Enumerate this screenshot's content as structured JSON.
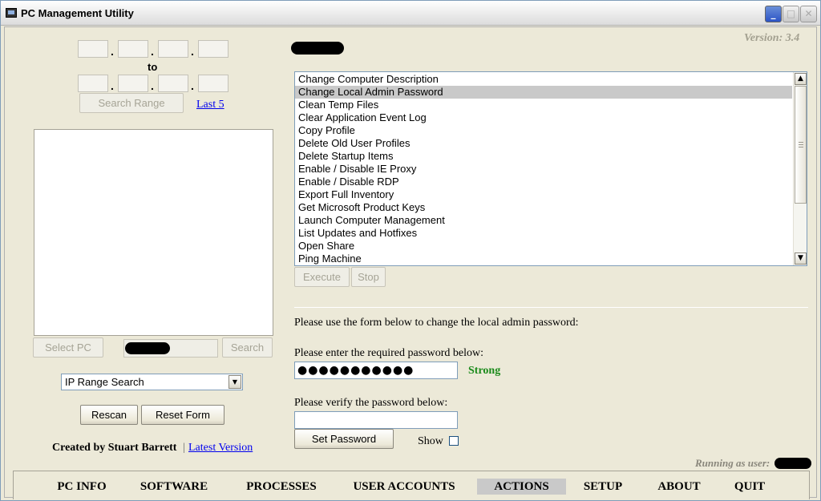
{
  "window": {
    "title": "PC Management Utility",
    "controls": {
      "minimize": "_",
      "maximize": "□",
      "close": "✕"
    }
  },
  "version": "Version: 3.4",
  "ip_range": {
    "separator": ".",
    "to_label": "to",
    "search_range_label": "Search Range",
    "last5_label": "Last 5"
  },
  "pc_list": {
    "select_pc_label": "Select PC",
    "search_label": "Search",
    "search_mode_selected": "IP Range Search"
  },
  "left_buttons": {
    "rescan": "Rescan",
    "reset_form": "Reset Form"
  },
  "credits": {
    "created_by": "Created by Stuart Barrett",
    "separator": "|",
    "latest_version": "Latest Version"
  },
  "actions": {
    "items": [
      "Change Computer Description",
      "Change Local Admin Password",
      "Clean Temp Files",
      "Clear Application Event Log",
      "Copy Profile",
      "Delete Old User Profiles",
      "Delete Startup Items",
      "Enable / Disable IE Proxy",
      "Enable / Disable RDP",
      "Export Full Inventory",
      "Get Microsoft Product Keys",
      "Launch Computer Management",
      "List Updates and Hotfixes",
      "Open Share",
      "Ping Machine"
    ],
    "selected_index": 1,
    "execute_label": "Execute",
    "stop_label": "Stop"
  },
  "password_form": {
    "intro": "Please use the form below to change the local admin password:",
    "enter_label": "Please enter the required password below:",
    "password_value": "●●●●●●●●●●●",
    "strength": "Strong",
    "strength_color": "#1a8a1a",
    "verify_label": "Please verify the password below:",
    "verify_value": "",
    "set_password_label": "Set Password",
    "show_label": "Show"
  },
  "status": {
    "running_as": "Running as user:"
  },
  "nav": {
    "items": [
      "PC INFO",
      "SOFTWARE",
      "PROCESSES",
      "USER ACCOUNTS",
      "ACTIONS",
      "SETUP",
      "ABOUT",
      "QUIT"
    ],
    "active": "ACTIONS"
  }
}
